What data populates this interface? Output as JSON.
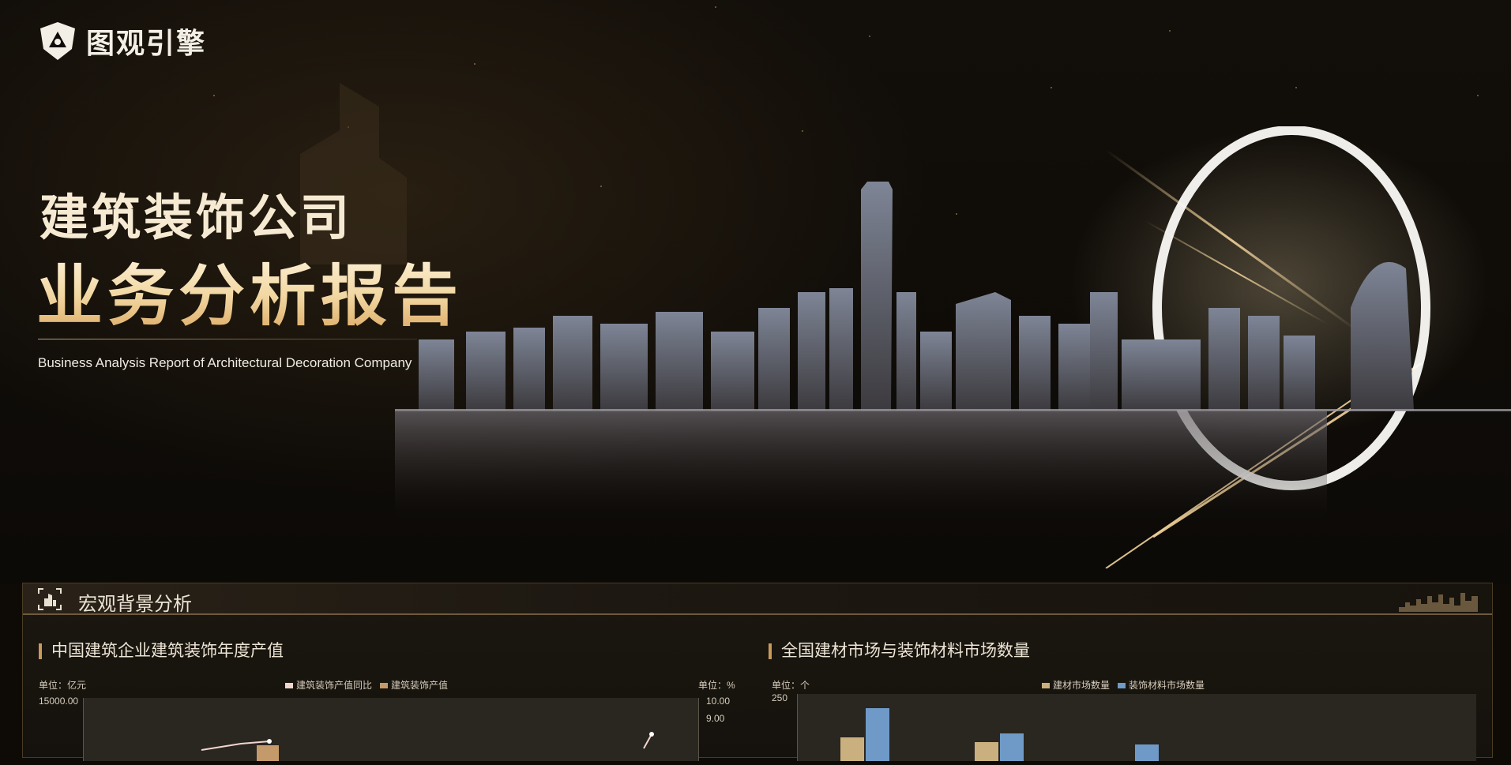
{
  "brand": {
    "name": "图观引擎",
    "logo_icon": "shield-triangle-icon"
  },
  "hero": {
    "title_line1": "建筑装饰公司",
    "title_line2": "业务分析报告",
    "subtitle": "Business Analysis Report of Architectural Decoration Company"
  },
  "section": {
    "title": "宏观背景分析",
    "icon": "building-frame-icon"
  },
  "charts": [
    {
      "title": "中国建筑企业建筑装饰年度产值",
      "unit_left": "单位：亿元",
      "unit_right": "单位：%",
      "legend": [
        {
          "label": "建筑装饰产值同比",
          "color": "#f1d6d0"
        },
        {
          "label": "建筑装饰产值",
          "color": "#c59a6b"
        }
      ],
      "y_left_top": "15000.00",
      "y_right_ticks": [
        "10.00",
        "9.00"
      ]
    },
    {
      "title": "全国建材市场与装饰材料市场数量",
      "unit_left": "单位：个",
      "legend": [
        {
          "label": "建材市场数量",
          "color": "#c9b07e"
        },
        {
          "label": "装饰材料市场数量",
          "color": "#6f9ac8"
        }
      ],
      "y_left_top": "250"
    }
  ],
  "colors": {
    "accent": "#c89a5c",
    "panel_border": "#4a3b25",
    "bar_gold": "#c9b07e",
    "bar_blue": "#6f9ac8"
  }
}
